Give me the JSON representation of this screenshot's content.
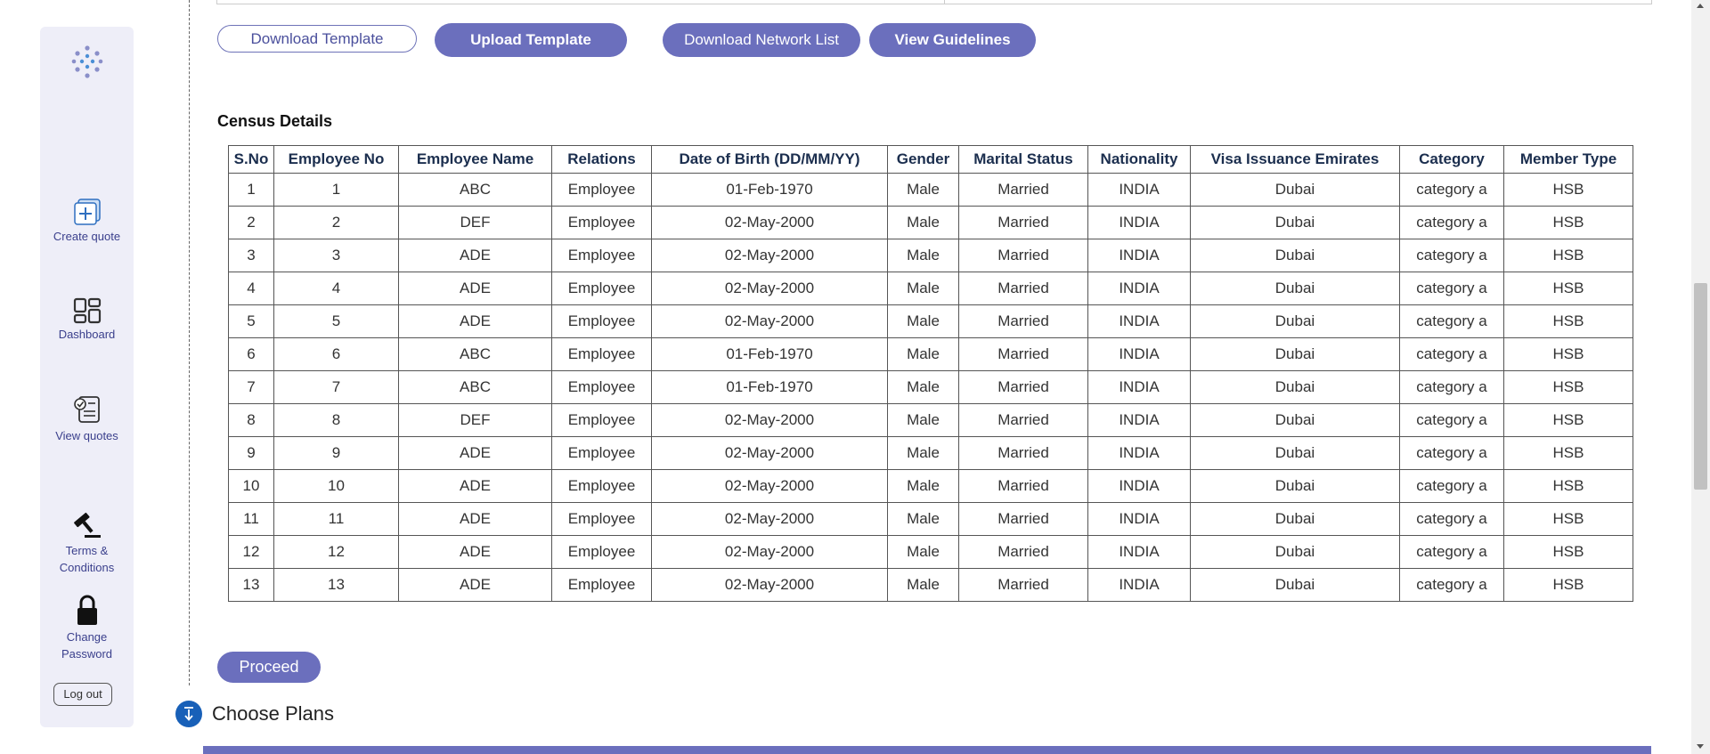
{
  "sidebar": {
    "items": [
      {
        "label": "Create quote",
        "icon": "create-quote-icon"
      },
      {
        "label": "Dashboard",
        "icon": "dashboard-icon"
      },
      {
        "label": "View quotes",
        "icon": "view-quotes-icon"
      },
      {
        "label_line1": "Terms &",
        "label_line2": "Conditions",
        "icon": "gavel-icon"
      },
      {
        "label_line1": "Change",
        "label_line2": "Password",
        "icon": "lock-icon"
      }
    ],
    "logout_label": "Log out"
  },
  "toolbar": {
    "download_template": "Download Template",
    "upload_template": "Upload Template",
    "download_network_list": "Download Network List",
    "view_guidelines": "View Guidelines"
  },
  "census": {
    "title": "Census Details",
    "columns": [
      "S.No",
      "Employee No",
      "Employee Name",
      "Relations",
      "Date of Birth (DD/MM/YY)",
      "Gender",
      "Marital Status",
      "Nationality",
      "Visa Issuance Emirates",
      "Category",
      "Member Type"
    ],
    "rows": [
      [
        "1",
        "1",
        "ABC",
        "Employee",
        "01-Feb-1970",
        "Male",
        "Married",
        "INDIA",
        "Dubai",
        "category a",
        "HSB"
      ],
      [
        "2",
        "2",
        "DEF",
        "Employee",
        "02-May-2000",
        "Male",
        "Married",
        "INDIA",
        "Dubai",
        "category a",
        "HSB"
      ],
      [
        "3",
        "3",
        "ADE",
        "Employee",
        "02-May-2000",
        "Male",
        "Married",
        "INDIA",
        "Dubai",
        "category a",
        "HSB"
      ],
      [
        "4",
        "4",
        "ADE",
        "Employee",
        "02-May-2000",
        "Male",
        "Married",
        "INDIA",
        "Dubai",
        "category a",
        "HSB"
      ],
      [
        "5",
        "5",
        "ADE",
        "Employee",
        "02-May-2000",
        "Male",
        "Married",
        "INDIA",
        "Dubai",
        "category a",
        "HSB"
      ],
      [
        "6",
        "6",
        "ABC",
        "Employee",
        "01-Feb-1970",
        "Male",
        "Married",
        "INDIA",
        "Dubai",
        "category a",
        "HSB"
      ],
      [
        "7",
        "7",
        "ABC",
        "Employee",
        "01-Feb-1970",
        "Male",
        "Married",
        "INDIA",
        "Dubai",
        "category a",
        "HSB"
      ],
      [
        "8",
        "8",
        "DEF",
        "Employee",
        "02-May-2000",
        "Male",
        "Married",
        "INDIA",
        "Dubai",
        "category a",
        "HSB"
      ],
      [
        "9",
        "9",
        "ADE",
        "Employee",
        "02-May-2000",
        "Male",
        "Married",
        "INDIA",
        "Dubai",
        "category a",
        "HSB"
      ],
      [
        "10",
        "10",
        "ADE",
        "Employee",
        "02-May-2000",
        "Male",
        "Married",
        "INDIA",
        "Dubai",
        "category a",
        "HSB"
      ],
      [
        "11",
        "11",
        "ADE",
        "Employee",
        "02-May-2000",
        "Male",
        "Married",
        "INDIA",
        "Dubai",
        "category a",
        "HSB"
      ],
      [
        "12",
        "12",
        "ADE",
        "Employee",
        "02-May-2000",
        "Male",
        "Married",
        "INDIA",
        "Dubai",
        "category a",
        "HSB"
      ],
      [
        "13",
        "13",
        "ADE",
        "Employee",
        "02-May-2000",
        "Male",
        "Married",
        "INDIA",
        "Dubai",
        "category a",
        "HSB"
      ]
    ]
  },
  "proceed_label": "Proceed",
  "choose_plans": {
    "label": "Choose Plans",
    "icon": "download-arrow-icon"
  },
  "colors": {
    "accent": "#6b6fbd",
    "header_text": "#1b2e4e",
    "info_blue": "#1860b8",
    "sidebar_bg": "#eeeef8"
  }
}
